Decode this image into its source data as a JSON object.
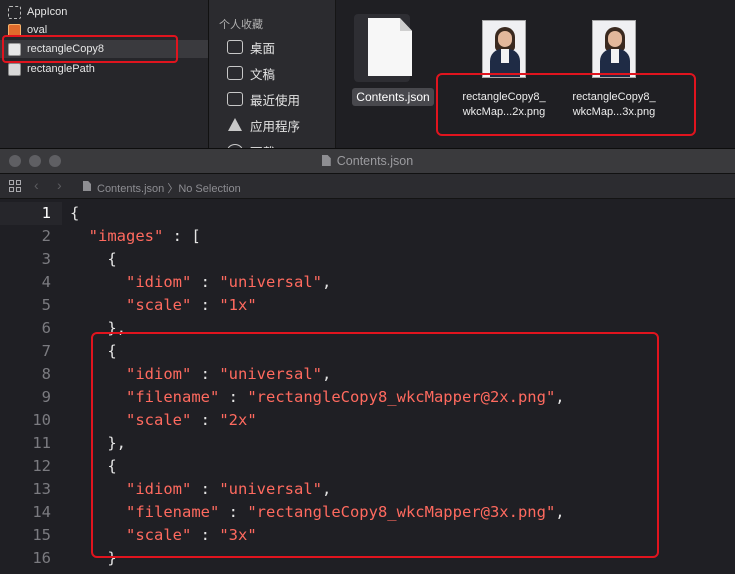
{
  "assets": {
    "items": [
      {
        "label": "AppIcon",
        "icon": "appicon-placeholder-icon"
      },
      {
        "label": "oval",
        "icon": "image-set-icon"
      },
      {
        "label": "rectangleCopy8",
        "icon": "image-set-icon",
        "selected": true
      },
      {
        "label": "rectanglePath",
        "icon": "image-set-icon"
      }
    ]
  },
  "finder": {
    "favorites_heading": "个人收藏",
    "favorites": [
      {
        "label": "桌面",
        "icon": "desktop-icon"
      },
      {
        "label": "文稿",
        "icon": "documents-icon"
      },
      {
        "label": "最近使用",
        "icon": "recents-icon"
      },
      {
        "label": "应用程序",
        "icon": "applications-icon"
      },
      {
        "label": "下载",
        "icon": "downloads-icon"
      }
    ],
    "files": [
      {
        "line1": "Contents.json",
        "line2": ""
      },
      {
        "line1": "rectangleCopy8_",
        "line2": "wkcMap...2x.png"
      },
      {
        "line1": "rectangleCopy8_",
        "line2": "wkcMap...3x.png"
      }
    ]
  },
  "editor": {
    "window_title": "Contents.json",
    "breadcrumb": "Contents.json 〉No Selection",
    "current_line": 1,
    "lines": [
      {
        "n": "1",
        "parts": [
          {
            "t": "{",
            "c": "p"
          }
        ]
      },
      {
        "n": "2",
        "parts": [
          {
            "t": "  ",
            "c": "p"
          },
          {
            "t": "\"images\"",
            "c": "s"
          },
          {
            "t": " : [",
            "c": "p"
          }
        ]
      },
      {
        "n": "3",
        "parts": [
          {
            "t": "    {",
            "c": "p"
          }
        ]
      },
      {
        "n": "4",
        "parts": [
          {
            "t": "      ",
            "c": "p"
          },
          {
            "t": "\"idiom\"",
            "c": "s"
          },
          {
            "t": " : ",
            "c": "p"
          },
          {
            "t": "\"universal\"",
            "c": "s"
          },
          {
            "t": ",",
            "c": "p"
          }
        ]
      },
      {
        "n": "5",
        "parts": [
          {
            "t": "      ",
            "c": "p"
          },
          {
            "t": "\"scale\"",
            "c": "s"
          },
          {
            "t": " : ",
            "c": "p"
          },
          {
            "t": "\"1x\"",
            "c": "s"
          }
        ]
      },
      {
        "n": "6",
        "parts": [
          {
            "t": "    },",
            "c": "p"
          }
        ]
      },
      {
        "n": "7",
        "parts": [
          {
            "t": "    {",
            "c": "p"
          }
        ]
      },
      {
        "n": "8",
        "parts": [
          {
            "t": "      ",
            "c": "p"
          },
          {
            "t": "\"idiom\"",
            "c": "s"
          },
          {
            "t": " : ",
            "c": "p"
          },
          {
            "t": "\"universal\"",
            "c": "s"
          },
          {
            "t": ",",
            "c": "p"
          }
        ]
      },
      {
        "n": "9",
        "parts": [
          {
            "t": "      ",
            "c": "p"
          },
          {
            "t": "\"filename\"",
            "c": "s"
          },
          {
            "t": " : ",
            "c": "p"
          },
          {
            "t": "\"rectangleCopy8_wkcMapper@2x.png\"",
            "c": "s"
          },
          {
            "t": ",",
            "c": "p"
          }
        ]
      },
      {
        "n": "10",
        "parts": [
          {
            "t": "      ",
            "c": "p"
          },
          {
            "t": "\"scale\"",
            "c": "s"
          },
          {
            "t": " : ",
            "c": "p"
          },
          {
            "t": "\"2x\"",
            "c": "s"
          }
        ]
      },
      {
        "n": "11",
        "parts": [
          {
            "t": "    },",
            "c": "p"
          }
        ]
      },
      {
        "n": "12",
        "parts": [
          {
            "t": "    {",
            "c": "p"
          }
        ]
      },
      {
        "n": "13",
        "parts": [
          {
            "t": "      ",
            "c": "p"
          },
          {
            "t": "\"idiom\"",
            "c": "s"
          },
          {
            "t": " : ",
            "c": "p"
          },
          {
            "t": "\"universal\"",
            "c": "s"
          },
          {
            "t": ",",
            "c": "p"
          }
        ]
      },
      {
        "n": "14",
        "parts": [
          {
            "t": "      ",
            "c": "p"
          },
          {
            "t": "\"filename\"",
            "c": "s"
          },
          {
            "t": " : ",
            "c": "p"
          },
          {
            "t": "\"rectangleCopy8_wkcMapper@3x.png\"",
            "c": "s"
          },
          {
            "t": ",",
            "c": "p"
          }
        ]
      },
      {
        "n": "15",
        "parts": [
          {
            "t": "      ",
            "c": "p"
          },
          {
            "t": "\"scale\"",
            "c": "s"
          },
          {
            "t": " : ",
            "c": "p"
          },
          {
            "t": "\"3x\"",
            "c": "s"
          }
        ]
      },
      {
        "n": "16",
        "parts": [
          {
            "t": "    }",
            "c": "p"
          }
        ]
      }
    ]
  },
  "colors": {
    "highlight_box": "#e0141e",
    "string": "#ff6a5f",
    "editor_bg": "#1f1f24"
  }
}
